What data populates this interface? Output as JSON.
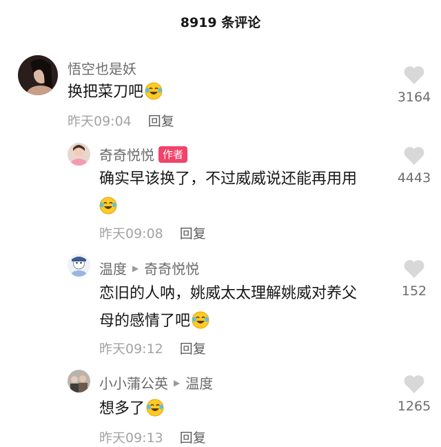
{
  "header": {
    "title": "8919 条评论"
  },
  "comments": [
    {
      "user": "悟空也是妖",
      "text": "换把菜刀吧",
      "time": "昨天09:04",
      "reply_label": "回复",
      "likes": "3164",
      "avatar_icon": "avatar-photo-woman",
      "emoji": "laughing-crying-emoji"
    },
    {
      "user": "奇奇悦悦",
      "badge": "作者",
      "text_line1": "确实早该换了，不过威威说还能再用用",
      "time": "昨天09:08",
      "reply_label": "回复",
      "likes": "4443",
      "avatar_icon": "avatar-photo-girl",
      "emoji": "laughing-crying-emoji"
    },
    {
      "user": "温度",
      "reply_to": "奇奇悦悦",
      "text_line1": "恋旧的人呐，姚威太太理解姚威对养父",
      "text_line2": "母的感情了吧",
      "time": "昨天09:12",
      "reply_label": "回复",
      "likes": "152",
      "avatar_icon": "avatar-cartoon",
      "emoji": "laughing-crying-emoji"
    },
    {
      "user": "小小蒲公英",
      "reply_to": "温度",
      "text": "想多了",
      "time": "昨天09:13",
      "reply_label": "回复",
      "likes": "1265",
      "avatar_icon": "avatar-photo-group",
      "emoji": "laughing-crying-emoji"
    }
  ],
  "colors": {
    "badge": "#f2436a",
    "meta": "#a3a3a3",
    "heart": "#d8d8d8",
    "emoji": "#ffca28"
  }
}
